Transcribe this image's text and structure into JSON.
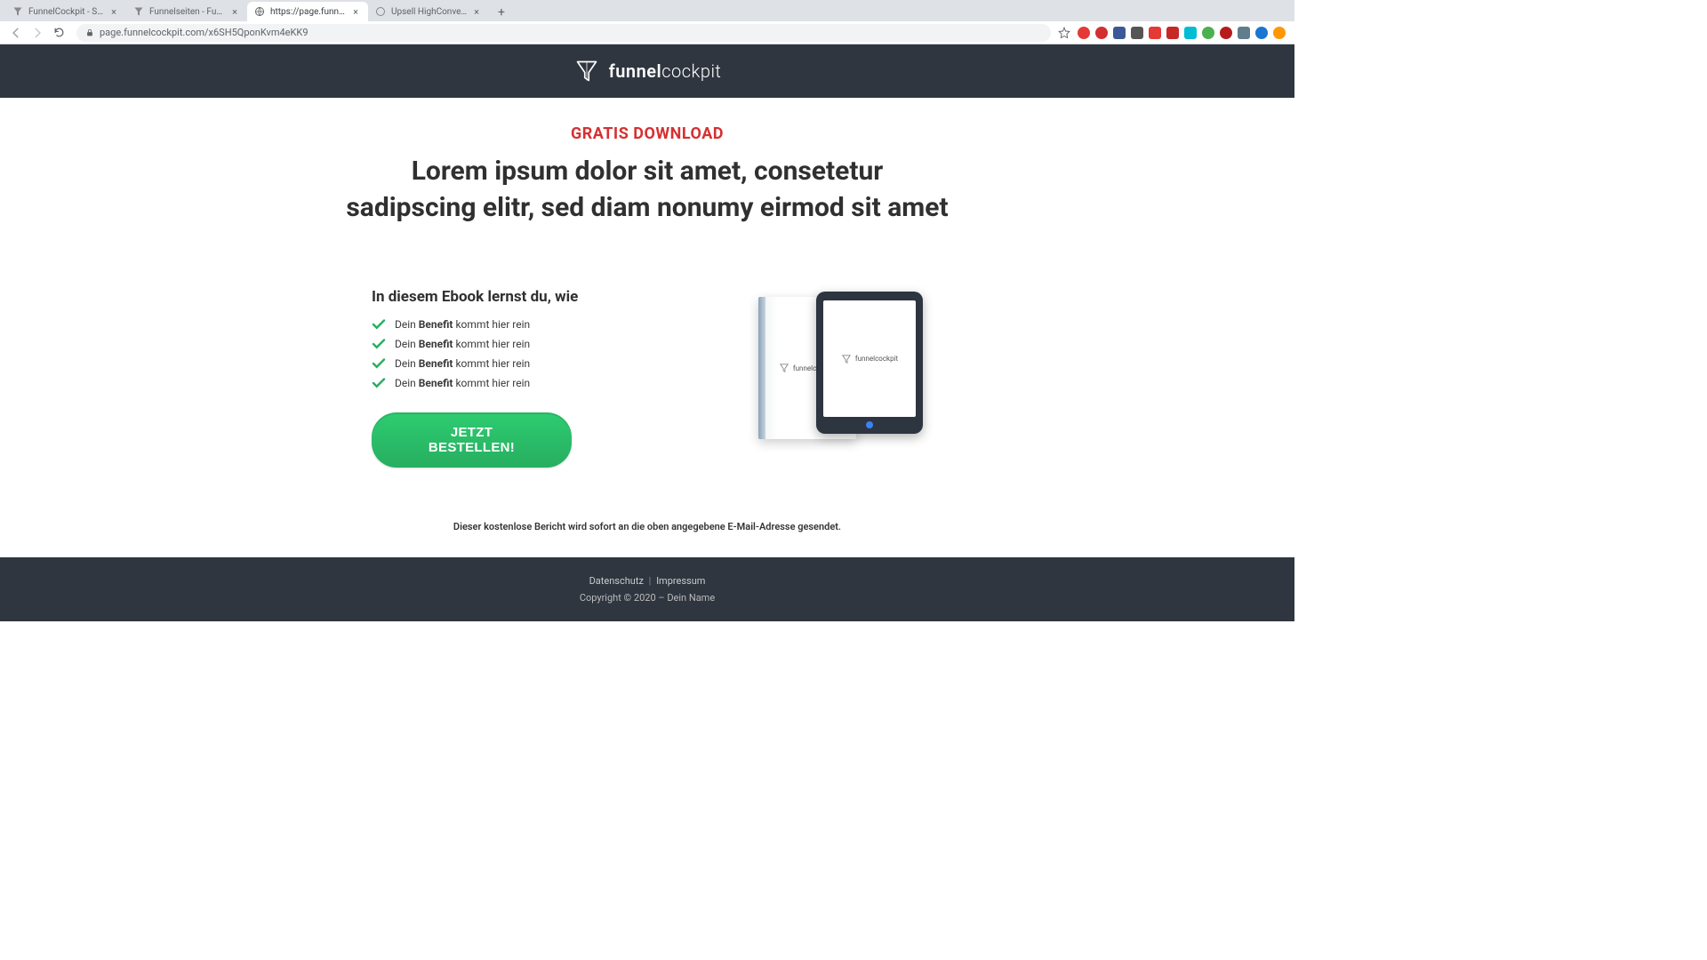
{
  "browser": {
    "tabs": [
      {
        "title": "FunnelCockpit - Splittests, Ma",
        "active": false
      },
      {
        "title": "Funnelseiten - FunnelCockpit",
        "active": false
      },
      {
        "title": "https://page.funnelcockpit.co",
        "active": true
      },
      {
        "title": "Upsell HighConversion",
        "active": false
      }
    ],
    "url": "page.funnelcockpit.com/x6SH5QponKvm4eKK9"
  },
  "header": {
    "brand_prefix": "funnel",
    "brand_suffix": "cockpit"
  },
  "overline": "GRATIS DOWNLOAD",
  "headline": "Lorem ipsum dolor sit amet, consetetur sadipscing elitr, sed diam nonumy eirmod sit amet",
  "subhead": "In diesem Ebook lernst du, wie",
  "benefits": [
    {
      "pre": "Dein ",
      "bold": "Benefit",
      "post": " kommt hier rein"
    },
    {
      "pre": "Dein ",
      "bold": "Benefit",
      "post": " kommt hier rein"
    },
    {
      "pre": "Dein ",
      "bold": "Benefit",
      "post": " kommt hier rein"
    },
    {
      "pre": "Dein ",
      "bold": "Benefit",
      "post": " kommt hier rein"
    }
  ],
  "cta_label": "JETZT BESTELLEN!",
  "mockup_logo_prefix": "funnel",
  "mockup_logo_suffix": "cockpit",
  "disclaimer": "Dieser kostenlose Bericht wird sofort an die oben angegebene E-Mail-Adresse gesendet.",
  "footer": {
    "link1": "Datenschutz",
    "link2": "Impressum",
    "copyright": "Copyright © 2020 – Dein Name"
  }
}
